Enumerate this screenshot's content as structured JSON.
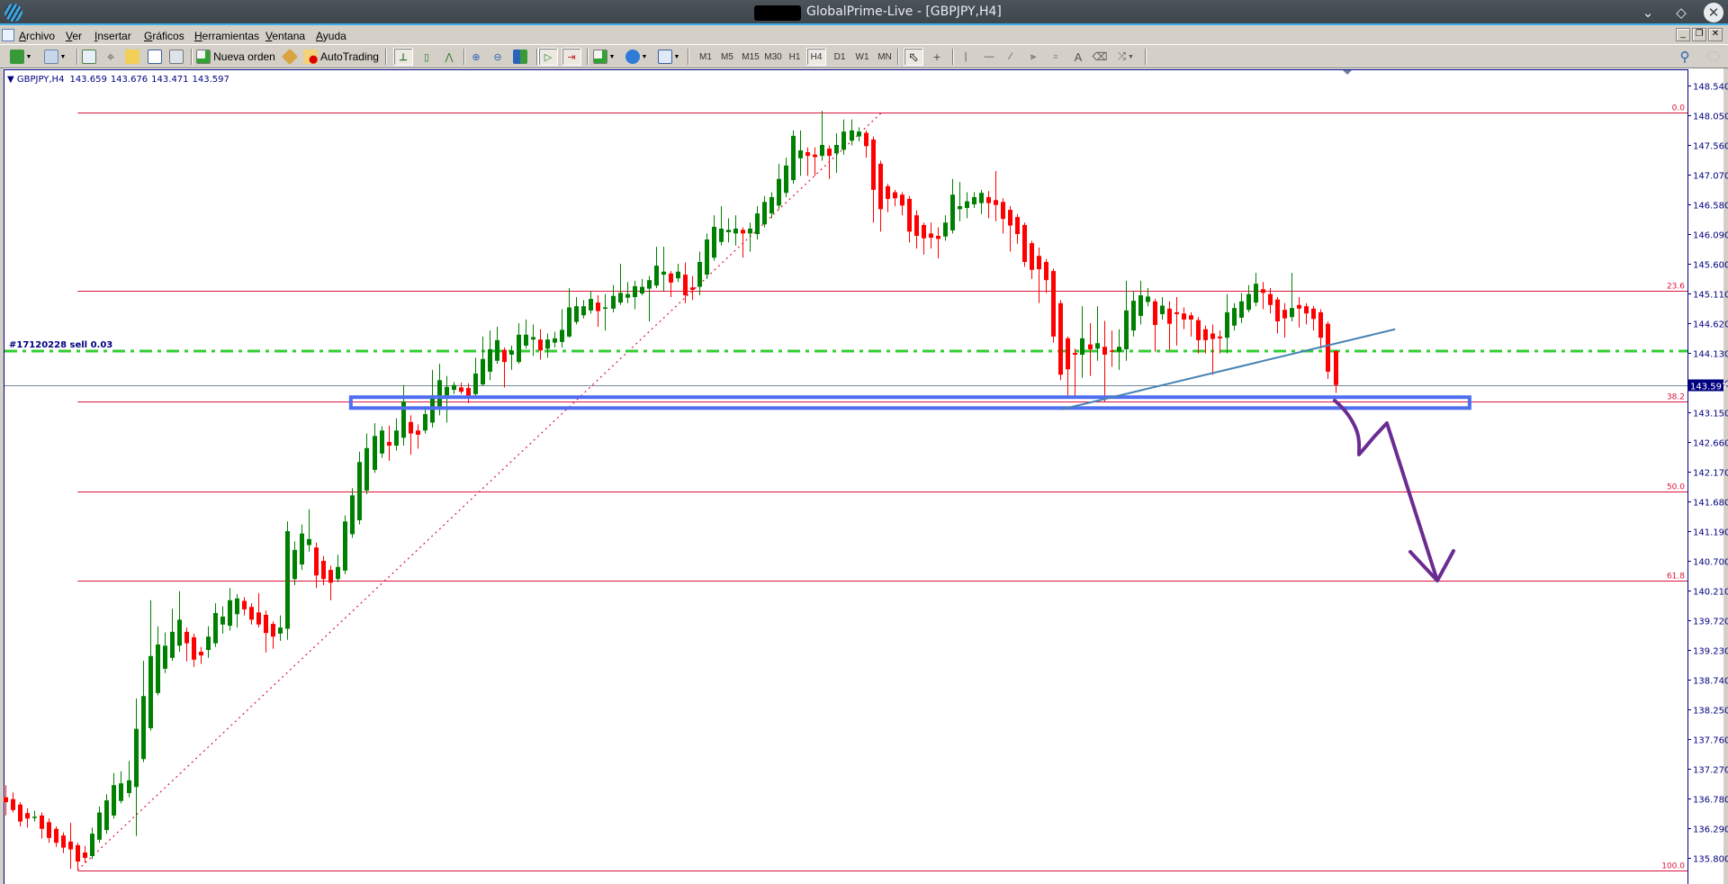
{
  "window": {
    "title": "GlobalPrime-Live - [GBPJPY,H4]"
  },
  "menu": [
    "Archivo",
    "Ver",
    "Insertar",
    "Gráficos",
    "Herramientas",
    "Ventana",
    "Ayuda"
  ],
  "toolbar": {
    "new_order": "Nueva orden",
    "autotrading": "AutoTrading",
    "timeframes": [
      "M1",
      "M5",
      "M15",
      "M30",
      "H1",
      "H4",
      "D1",
      "W1",
      "MN"
    ],
    "active_timeframe": "H4"
  },
  "chart_header": {
    "symbol": "GBPJPY,H4",
    "open": "143.659",
    "high": "143.676",
    "low": "143.471",
    "close": "143.597"
  },
  "order_label": "#17120228 sell 0.03",
  "current_price_label": "143.597",
  "chart_data": {
    "type": "candlestick",
    "symbol": "GBPJPY",
    "timeframe": "H4",
    "colors": {
      "bull": "#008000",
      "bear": "#ff0000",
      "fib": "#dc143c",
      "order": "#32cd32",
      "zone": "#4f6ef0",
      "trend": "#4682b4",
      "arrow": "#6a2c91"
    },
    "y_ticks": [
      "148.540",
      "148.050",
      "147.560",
      "147.070",
      "146.580",
      "146.090",
      "145.600",
      "145.110",
      "144.620",
      "144.130",
      "143.640",
      "143.150",
      "142.660",
      "142.170",
      "141.680",
      "141.190",
      "140.700",
      "140.210",
      "139.720",
      "139.230",
      "138.740",
      "138.250",
      "137.760",
      "137.270",
      "136.780",
      "136.290",
      "135.800"
    ],
    "current_price": 143.597,
    "order_line_price": 144.16,
    "fib_levels": [
      {
        "label": "0.0",
        "price": 148.1
      },
      {
        "label": "23.6",
        "price": 145.15
      },
      {
        "label": "38.2",
        "price": 143.325
      },
      {
        "label": "50.0",
        "price": 141.85
      },
      {
        "label": "61.8",
        "price": 140.375
      },
      {
        "label": "100.0",
        "price": 135.6
      }
    ],
    "fib_anchor": {
      "from": {
        "bar": 10,
        "price": 135.6
      },
      "to": {
        "bar": 121.3,
        "price": 148.1
      }
    },
    "support_zone": {
      "from_bar": 47.8,
      "to_bar": 202.6,
      "top": 143.4,
      "bottom": 143.22
    },
    "trendline": {
      "from": {
        "bar": 146.2,
        "price": 143.2
      },
      "to": {
        "bar": 192.3,
        "price": 144.52
      }
    },
    "ohlc": [
      [
        136.8,
        137.0,
        136.5,
        136.72
      ],
      [
        136.77,
        136.88,
        136.55,
        136.59
      ],
      [
        136.68,
        136.72,
        136.32,
        136.4
      ],
      [
        136.54,
        136.62,
        136.3,
        136.45
      ],
      [
        136.46,
        136.58,
        136.4,
        136.48
      ],
      [
        136.5,
        136.55,
        136.12,
        136.28
      ],
      [
        136.39,
        136.45,
        136.05,
        136.13
      ],
      [
        136.28,
        136.32,
        135.98,
        136.05
      ],
      [
        136.17,
        136.22,
        135.88,
        135.97
      ],
      [
        136.07,
        136.38,
        135.62,
        135.94
      ],
      [
        136.01,
        136.05,
        135.6,
        135.74
      ],
      [
        135.89,
        136.0,
        135.72,
        135.8
      ],
      [
        135.83,
        136.3,
        135.78,
        136.2
      ],
      [
        136.1,
        136.65,
        136.05,
        136.55
      ],
      [
        136.26,
        136.85,
        136.2,
        136.75
      ],
      [
        136.5,
        137.2,
        136.45,
        137.0
      ],
      [
        136.74,
        137.23,
        136.7,
        137.03
      ],
      [
        136.87,
        137.4,
        136.8,
        137.08
      ],
      [
        136.97,
        138.43,
        136.16,
        137.93
      ],
      [
        137.43,
        139.05,
        137.38,
        138.47
      ],
      [
        137.94,
        140.05,
        137.9,
        139.13
      ],
      [
        138.52,
        139.62,
        138.48,
        139.32
      ],
      [
        138.92,
        139.52,
        138.85,
        139.3
      ],
      [
        139.1,
        139.91,
        139.05,
        139.53
      ],
      [
        139.3,
        140.2,
        139.2,
        139.73
      ],
      [
        139.53,
        139.6,
        139.04,
        139.34
      ],
      [
        139.44,
        139.5,
        138.95,
        139.07
      ],
      [
        139.2,
        139.28,
        139.0,
        139.14
      ],
      [
        139.23,
        139.62,
        139.1,
        139.45
      ],
      [
        139.34,
        140.0,
        139.28,
        139.84
      ],
      [
        139.65,
        139.95,
        139.5,
        139.78
      ],
      [
        139.63,
        140.25,
        139.55,
        140.05
      ],
      [
        139.82,
        140.15,
        139.6,
        140.08
      ],
      [
        140.04,
        140.1,
        139.8,
        139.9
      ],
      [
        139.94,
        140.0,
        139.65,
        139.73
      ],
      [
        139.85,
        140.17,
        139.6,
        139.65
      ],
      [
        139.81,
        139.88,
        139.19,
        139.51
      ],
      [
        139.66,
        139.7,
        139.25,
        139.45
      ],
      [
        139.5,
        139.8,
        139.38,
        139.6
      ],
      [
        139.58,
        141.35,
        139.4,
        141.19
      ],
      [
        140.4,
        141.02,
        140.3,
        140.88
      ],
      [
        140.64,
        141.3,
        140.55,
        141.15
      ],
      [
        140.96,
        141.55,
        140.85,
        141.06
      ],
      [
        140.92,
        141.0,
        140.25,
        140.46
      ],
      [
        140.7,
        140.78,
        140.3,
        140.4
      ],
      [
        140.55,
        140.62,
        140.05,
        140.34
      ],
      [
        140.4,
        140.8,
        140.35,
        140.6
      ],
      [
        140.54,
        141.45,
        140.48,
        141.35
      ],
      [
        141.14,
        141.9,
        141.08,
        141.78
      ],
      [
        141.37,
        142.5,
        141.3,
        142.33
      ],
      [
        141.86,
        142.8,
        141.8,
        142.56
      ],
      [
        142.2,
        142.97,
        142.15,
        142.76
      ],
      [
        142.47,
        142.92,
        142.4,
        142.85
      ],
      [
        142.66,
        142.93,
        142.35,
        142.6
      ],
      [
        142.6,
        143.05,
        142.52,
        142.85
      ],
      [
        142.73,
        143.6,
        142.6,
        143.33
      ],
      [
        142.99,
        143.1,
        142.45,
        142.8
      ],
      [
        142.85,
        142.95,
        142.55,
        142.78
      ],
      [
        142.85,
        143.25,
        142.8,
        143.12
      ],
      [
        142.98,
        143.85,
        142.9,
        143.43
      ],
      [
        143.21,
        143.95,
        143.1,
        143.68
      ],
      [
        143.43,
        143.75,
        142.98,
        143.57
      ],
      [
        143.52,
        143.65,
        143.45,
        143.6
      ],
      [
        143.56,
        143.64,
        143.45,
        143.49
      ],
      [
        143.55,
        143.63,
        143.3,
        143.4
      ],
      [
        143.45,
        144.05,
        143.42,
        143.79
      ],
      [
        143.61,
        144.4,
        143.58,
        144.03
      ],
      [
        143.82,
        144.5,
        143.68,
        144.19
      ],
      [
        144.0,
        144.56,
        143.95,
        144.34
      ],
      [
        144.18,
        144.22,
        143.56,
        143.98
      ],
      [
        144.1,
        144.25,
        143.85,
        144.17
      ],
      [
        143.98,
        144.62,
        143.95,
        144.43
      ],
      [
        144.25,
        144.68,
        144.2,
        144.43
      ],
      [
        144.35,
        144.6,
        144.08,
        144.39
      ],
      [
        144.35,
        144.52,
        144.02,
        144.17
      ],
      [
        144.2,
        144.45,
        144.05,
        144.35
      ],
      [
        144.3,
        144.48,
        144.22,
        144.37
      ],
      [
        144.31,
        144.85,
        144.22,
        144.51
      ],
      [
        144.4,
        145.2,
        144.38,
        144.88
      ],
      [
        144.64,
        145.05,
        144.6,
        144.9
      ],
      [
        144.75,
        145.0,
        144.7,
        144.9
      ],
      [
        144.83,
        145.15,
        144.78,
        145.02
      ],
      [
        144.96,
        145.08,
        144.56,
        144.82
      ],
      [
        144.86,
        145.1,
        144.5,
        144.88
      ],
      [
        144.86,
        145.25,
        144.8,
        145.07
      ],
      [
        144.96,
        145.6,
        144.92,
        145.12
      ],
      [
        145.04,
        145.3,
        144.95,
        145.1
      ],
      [
        145.05,
        145.32,
        144.85,
        145.23
      ],
      [
        145.11,
        145.35,
        145.08,
        145.22
      ],
      [
        145.19,
        145.4,
        144.65,
        145.33
      ],
      [
        145.24,
        145.88,
        145.2,
        145.57
      ],
      [
        145.42,
        145.88,
        145.15,
        145.47
      ],
      [
        145.44,
        145.48,
        145.05,
        145.29
      ],
      [
        145.36,
        145.6,
        145.3,
        145.47
      ],
      [
        145.42,
        145.62,
        144.95,
        145.08
      ],
      [
        145.21,
        145.4,
        145.0,
        145.17
      ],
      [
        145.22,
        145.8,
        145.08,
        145.63
      ],
      [
        145.42,
        146.1,
        145.35,
        146.0
      ],
      [
        145.7,
        146.4,
        145.65,
        146.21
      ],
      [
        145.96,
        146.55,
        145.9,
        146.18
      ],
      [
        146.12,
        146.35,
        145.95,
        146.16
      ],
      [
        146.1,
        146.4,
        145.9,
        146.18
      ],
      [
        146.16,
        146.2,
        145.7,
        146.1
      ],
      [
        146.1,
        146.28,
        145.8,
        146.18
      ],
      [
        146.09,
        146.55,
        146.0,
        146.43
      ],
      [
        146.25,
        146.72,
        146.2,
        146.62
      ],
      [
        146.43,
        146.78,
        146.35,
        146.7
      ],
      [
        146.56,
        147.25,
        146.5,
        147.0
      ],
      [
        146.77,
        147.35,
        146.7,
        147.22
      ],
      [
        146.98,
        147.8,
        146.92,
        147.71
      ],
      [
        147.34,
        147.8,
        147.05,
        147.47
      ],
      [
        147.44,
        147.52,
        147.05,
        147.38
      ],
      [
        147.4,
        147.52,
        147.05,
        147.36
      ],
      [
        147.38,
        148.12,
        147.3,
        147.56
      ],
      [
        147.5,
        147.55,
        147.0,
        147.38
      ],
      [
        147.42,
        147.75,
        147.1,
        147.56
      ],
      [
        147.48,
        147.98,
        147.4,
        147.78
      ],
      [
        147.63,
        147.98,
        147.55,
        147.8
      ],
      [
        147.7,
        147.85,
        147.62,
        147.78
      ],
      [
        147.76,
        147.8,
        147.35,
        147.54
      ],
      [
        147.65,
        147.7,
        146.28,
        146.82
      ],
      [
        147.25,
        147.3,
        146.13,
        146.5
      ],
      [
        146.88,
        146.92,
        146.45,
        146.67
      ],
      [
        146.78,
        146.82,
        146.55,
        146.68
      ],
      [
        146.74,
        146.78,
        146.4,
        146.56
      ],
      [
        146.67,
        146.72,
        145.95,
        146.13
      ],
      [
        146.4,
        146.48,
        145.85,
        146.06
      ],
      [
        146.24,
        146.28,
        145.75,
        146.02
      ],
      [
        146.1,
        146.28,
        145.85,
        146.03
      ],
      [
        146.06,
        146.2,
        145.69,
        146.01
      ],
      [
        146.05,
        146.4,
        145.98,
        146.28
      ],
      [
        146.15,
        147.0,
        146.1,
        146.74
      ],
      [
        146.5,
        146.95,
        146.3,
        146.55
      ],
      [
        146.52,
        146.78,
        146.35,
        146.63
      ],
      [
        146.58,
        146.78,
        146.52,
        146.7
      ],
      [
        146.6,
        146.82,
        146.42,
        146.77
      ],
      [
        146.7,
        146.8,
        146.35,
        146.6
      ],
      [
        146.65,
        147.13,
        146.3,
        146.57
      ],
      [
        146.62,
        146.68,
        146.1,
        146.34
      ],
      [
        146.49,
        146.55,
        145.8,
        146.23
      ],
      [
        146.37,
        146.42,
        145.93,
        146.09
      ],
      [
        146.24,
        146.28,
        145.55,
        145.63
      ],
      [
        145.94,
        145.98,
        145.35,
        145.5
      ],
      [
        145.73,
        145.87,
        144.95,
        145.51
      ],
      [
        145.63,
        145.68,
        145.12,
        145.33
      ],
      [
        145.48,
        145.52,
        144.3,
        144.4
      ],
      [
        144.95,
        145.0,
        143.68,
        143.77
      ],
      [
        144.37,
        144.4,
        143.42,
        143.86
      ],
      [
        144.13,
        144.2,
        143.4,
        144.1
      ],
      [
        144.1,
        144.9,
        143.72,
        144.37
      ],
      [
        144.27,
        144.62,
        143.75,
        144.19
      ],
      [
        144.2,
        144.9,
        144.0,
        144.29
      ],
      [
        144.23,
        144.66,
        143.32,
        144.1
      ],
      [
        144.17,
        144.5,
        143.9,
        144.15
      ],
      [
        144.15,
        144.52,
        143.85,
        144.23
      ],
      [
        144.19,
        145.32,
        144.0,
        144.83
      ],
      [
        144.5,
        145.15,
        144.4,
        144.99
      ],
      [
        144.74,
        145.32,
        144.6,
        145.08
      ],
      [
        144.97,
        145.2,
        144.9,
        145.06
      ],
      [
        144.98,
        145.02,
        144.15,
        144.59
      ],
      [
        144.77,
        145.05,
        144.68,
        144.91
      ],
      [
        144.86,
        144.98,
        144.18,
        144.61
      ],
      [
        144.8,
        145.05,
        144.25,
        144.77
      ],
      [
        144.78,
        144.88,
        144.52,
        144.68
      ],
      [
        144.75,
        144.8,
        144.4,
        144.68
      ],
      [
        144.67,
        144.72,
        144.12,
        144.34
      ],
      [
        144.52,
        144.58,
        144.12,
        144.34
      ],
      [
        144.45,
        144.6,
        143.77,
        144.36
      ],
      [
        144.4,
        144.5,
        144.12,
        144.37
      ],
      [
        144.38,
        145.1,
        144.12,
        144.8
      ],
      [
        144.58,
        144.95,
        144.5,
        144.87
      ],
      [
        144.71,
        145.12,
        144.62,
        144.98
      ],
      [
        144.84,
        145.25,
        144.8,
        145.1
      ],
      [
        144.96,
        145.45,
        144.9,
        145.27
      ],
      [
        145.18,
        145.3,
        144.85,
        145.12
      ],
      [
        145.1,
        145.2,
        144.78,
        144.92
      ],
      [
        145.01,
        145.05,
        144.45,
        144.65
      ],
      [
        144.84,
        144.95,
        144.38,
        144.7
      ],
      [
        144.72,
        145.45,
        144.65,
        144.87
      ],
      [
        144.92,
        145.05,
        144.55,
        144.86
      ],
      [
        144.9,
        144.95,
        144.6,
        144.78
      ],
      [
        144.86,
        144.9,
        144.5,
        144.69
      ],
      [
        144.8,
        144.85,
        144.2,
        144.38
      ],
      [
        144.61,
        144.65,
        143.7,
        143.82
      ],
      [
        144.16,
        144.18,
        143.47,
        143.6
      ]
    ]
  }
}
